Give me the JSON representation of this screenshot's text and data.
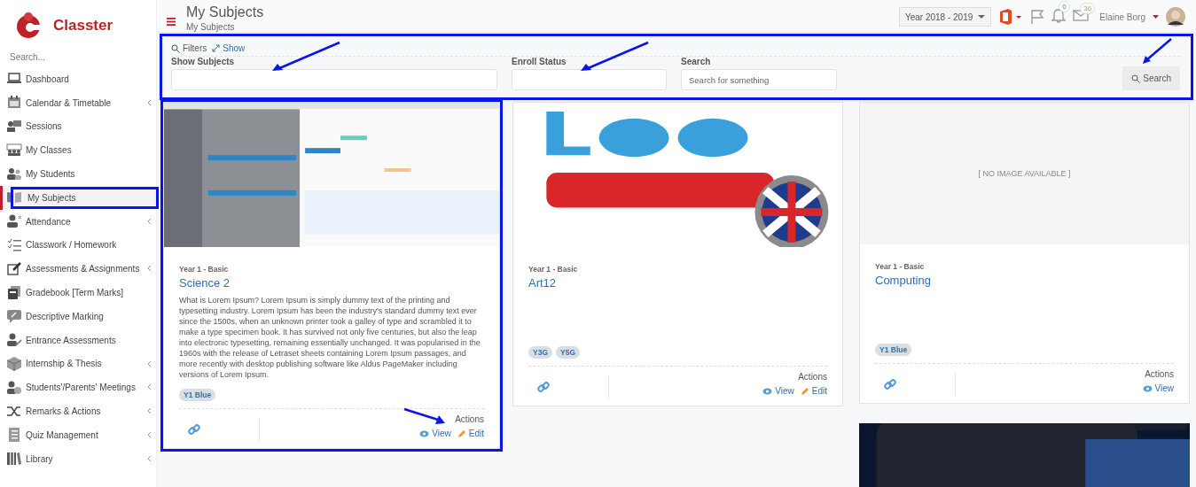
{
  "sidebar": {
    "brand": "Classter",
    "search": {
      "placeholder": "Search..."
    },
    "items": [
      {
        "label": "Dashboard",
        "expandable": false,
        "selected": false,
        "highlighted": false
      },
      {
        "label": "Calendar & Timetable",
        "expandable": true,
        "selected": false,
        "highlighted": false
      },
      {
        "label": "Sessions",
        "expandable": false,
        "selected": false,
        "highlighted": false
      },
      {
        "label": "My Classes",
        "expandable": false,
        "selected": false,
        "highlighted": false
      },
      {
        "label": "My Students",
        "expandable": false,
        "selected": false,
        "highlighted": false
      },
      {
        "label": "My Subjects",
        "expandable": false,
        "selected": true,
        "highlighted": true
      },
      {
        "label": "Attendance",
        "expandable": true,
        "selected": false,
        "highlighted": false
      },
      {
        "label": "Classwork / Homework",
        "expandable": false,
        "selected": false,
        "highlighted": false
      },
      {
        "label": "Assessments & Assignments",
        "expandable": true,
        "selected": false,
        "highlighted": false
      },
      {
        "label": "Gradebook [Term Marks]",
        "expandable": false,
        "selected": false,
        "highlighted": false
      },
      {
        "label": "Descriptive Marking",
        "expandable": false,
        "selected": false,
        "highlighted": false
      },
      {
        "label": "Entrance Assessments",
        "expandable": false,
        "selected": false,
        "highlighted": false
      },
      {
        "label": "Internship & Thesis",
        "expandable": true,
        "selected": false,
        "highlighted": false
      },
      {
        "label": "Students'/Parents' Meetings",
        "expandable": true,
        "selected": false,
        "highlighted": false
      },
      {
        "label": "Remarks & Actions",
        "expandable": true,
        "selected": false,
        "highlighted": false
      },
      {
        "label": "Quiz Management",
        "expandable": true,
        "selected": false,
        "highlighted": false
      },
      {
        "label": "Library",
        "expandable": true,
        "selected": false,
        "highlighted": false
      }
    ]
  },
  "header": {
    "title": "My Subjects",
    "breadcrumb": "My Subjects",
    "year": "Year 2018 - 2019",
    "notifications": "0",
    "messages": "36",
    "user": "Elaine Borg"
  },
  "filters": {
    "highlighted": true,
    "title": "Filters",
    "toggle": "Show",
    "fields": [
      {
        "label": "Show Subjects",
        "arrow": true
      },
      {
        "label": "Enroll Status",
        "arrow": true
      },
      {
        "label": "Search",
        "placeholder": "Search for something"
      }
    ],
    "button": {
      "label": "Search",
      "arrow": true
    }
  },
  "card_columns": [
    [
      {
        "highlighted": true,
        "level": "Year 1 - Basic",
        "title": "Science 2",
        "description": "What is Lorem Ipsum? Lorem Ipsum is simply dummy text of the printing and typesetting industry. Lorem Ipsum has been the industry's standard dummy text ever since the 1500s, when an unknown printer took a galley of type and scrambled it to make a type specimen book. It has survived not only five centuries, but also the leap into electronic typesetting, remaining essentially unchanged. It was popularised in the 1960s with the release of Letraset sheets containing Lorem Ipsum passages, and more recently with desktop publishing software like Aldus PageMaker including versions of Lorem Ipsum.",
        "tags": [
          "Y1 Blue"
        ],
        "actions_label": "Actions",
        "actions_arrow": true,
        "actions": [
          {
            "kind": "view",
            "label": "View"
          },
          {
            "kind": "edit",
            "label": "Edit"
          }
        ]
      }
    ],
    [
      {
        "highlighted": false,
        "level": "Year 1 - Basic",
        "title": "Art12",
        "tags": [
          "Y3G",
          "Y5G"
        ],
        "actions_label": "Actions",
        "actions_arrow": false,
        "actions": [
          {
            "kind": "view",
            "label": "View"
          },
          {
            "kind": "edit",
            "label": "Edit"
          }
        ]
      }
    ],
    [
      {
        "highlighted": false,
        "image_placeholder": "[ NO IMAGE AVAILABLE ]",
        "level": "Year 1 - Basic",
        "title": "Computing",
        "tags": [
          "Y1 Blue"
        ],
        "actions_label": "Actions",
        "actions_arrow": false,
        "actions": [
          {
            "kind": "view",
            "label": "View"
          }
        ]
      },
      {
        "kind": "picture"
      }
    ]
  ]
}
